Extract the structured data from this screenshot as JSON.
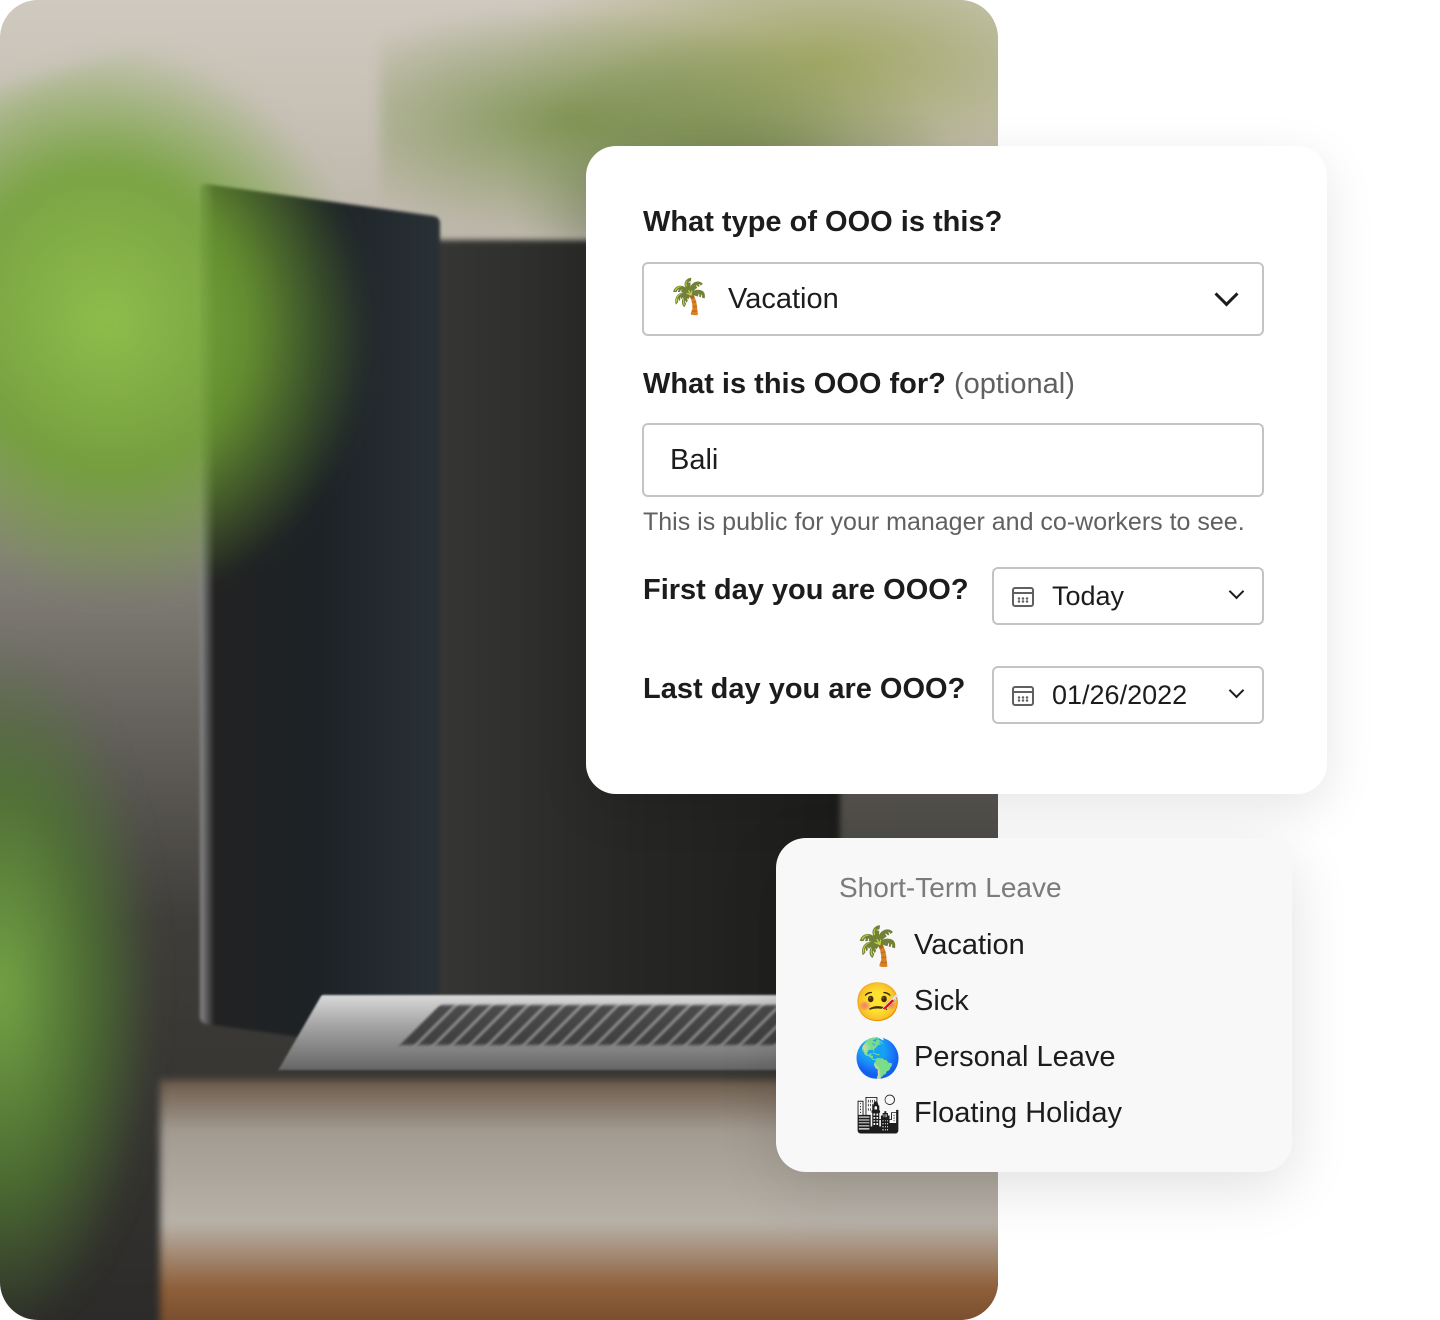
{
  "form": {
    "ooo_type_label": "What type of OOO is this?",
    "ooo_type_value": {
      "icon": "palm-tree-icon",
      "emoji": "🌴",
      "label": "Vacation"
    },
    "ooo_for_label": "What is this OOO for?",
    "ooo_for_optional": "(optional)",
    "ooo_for_value": "Bali",
    "ooo_for_help": "This is public for your manager and co-workers to see.",
    "first_day_label": "First day you are OOO?",
    "first_day_value": "Today",
    "last_day_label": "Last day you are OOO?",
    "last_day_value": "01/26/2022"
  },
  "dropdown": {
    "heading": "Short-Term Leave",
    "items": [
      {
        "icon": "palm-tree-icon",
        "emoji": "🌴",
        "label": "Vacation"
      },
      {
        "icon": "sick-face-icon",
        "emoji": "🤒",
        "label": "Sick"
      },
      {
        "icon": "globe-icon",
        "emoji": "🌎",
        "label": "Personal Leave"
      },
      {
        "icon": "city-skyline-icon",
        "emoji": "🏙",
        "label": "Floating Holiday"
      }
    ]
  }
}
